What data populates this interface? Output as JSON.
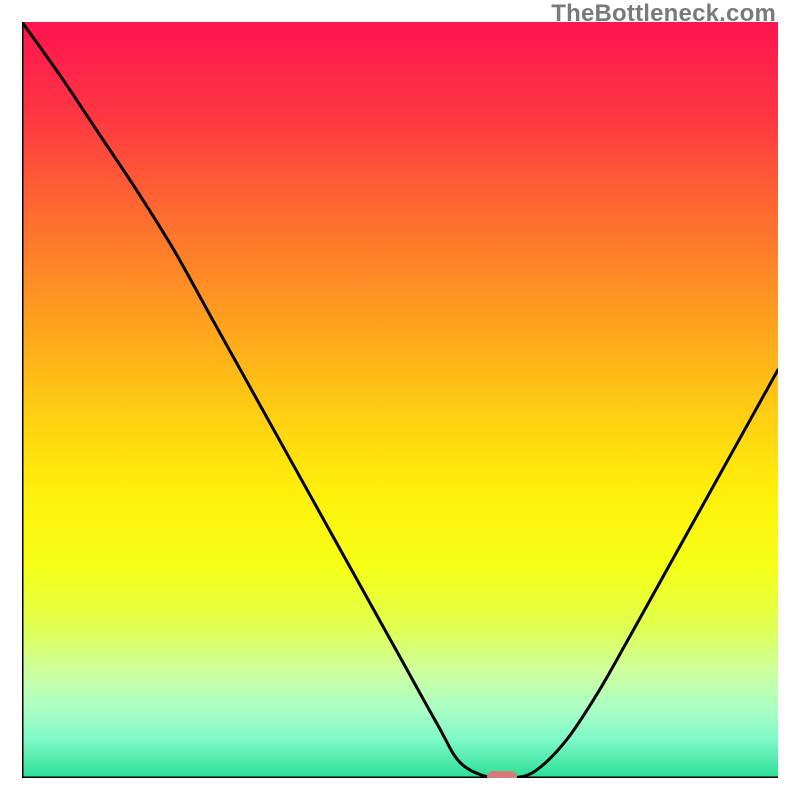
{
  "watermark": "TheBottleneck.com",
  "chart_data": {
    "type": "line",
    "title": "",
    "xlabel": "",
    "ylabel": "",
    "xlim": [
      0,
      100
    ],
    "ylim": [
      0,
      100
    ],
    "grid": false,
    "legend": false,
    "series": [
      {
        "name": "bottleneck-curve",
        "x": [
          0,
          5,
          10,
          15,
          20,
          25,
          30,
          35,
          40,
          45,
          50,
          55,
          58,
          62,
          65,
          68,
          72,
          76,
          80,
          85,
          90,
          95,
          100
        ],
        "y": [
          100,
          93,
          85.5,
          78,
          70,
          61,
          52,
          43,
          34,
          25,
          16,
          7,
          2,
          0,
          0,
          1,
          5,
          11,
          18,
          27,
          36,
          45,
          54
        ]
      }
    ],
    "marker": {
      "name": "optimal-point",
      "x": 63.5,
      "y": 0,
      "color": "#d87a7a",
      "shape": "rounded-rect"
    },
    "background_gradient": {
      "stops": [
        {
          "offset": 0.0,
          "color": "#ff1450"
        },
        {
          "offset": 0.12,
          "color": "#ff3543"
        },
        {
          "offset": 0.25,
          "color": "#ff6a30"
        },
        {
          "offset": 0.38,
          "color": "#ff9a20"
        },
        {
          "offset": 0.5,
          "color": "#ffc813"
        },
        {
          "offset": 0.62,
          "color": "#fff00a"
        },
        {
          "offset": 0.72,
          "color": "#f5ff15"
        },
        {
          "offset": 0.8,
          "color": "#e0ff50"
        },
        {
          "offset": 0.86,
          "color": "#ccffa0"
        },
        {
          "offset": 0.91,
          "color": "#aaffc5"
        },
        {
          "offset": 0.95,
          "color": "#7cf8c8"
        },
        {
          "offset": 1.0,
          "color": "#2adf95"
        }
      ]
    }
  }
}
